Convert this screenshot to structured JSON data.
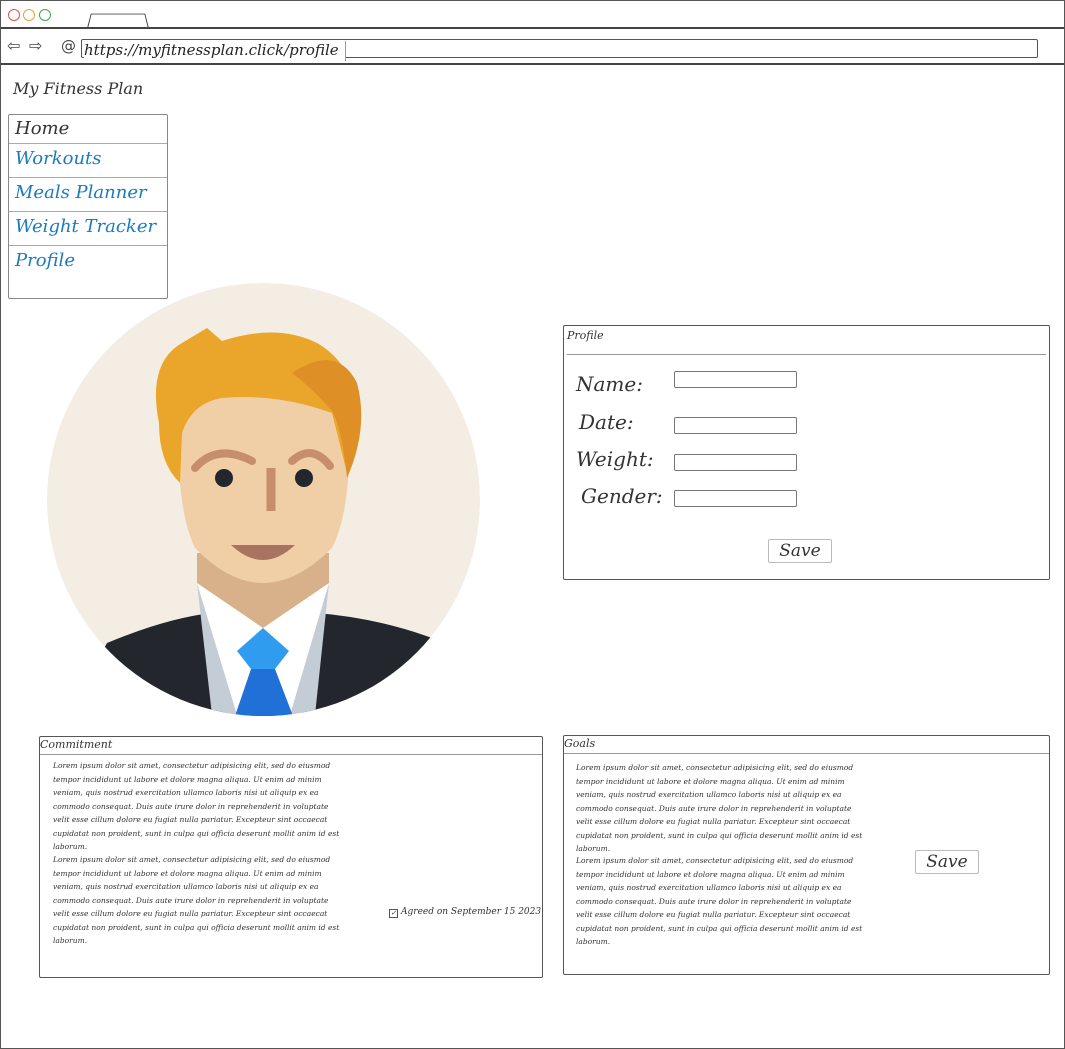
{
  "browser": {
    "url": "https://myfitnessplan.click/profile",
    "dot_colors": [
      "#d9534f",
      "#e8a33a",
      "#3fa34d"
    ]
  },
  "app": {
    "title": "My Fitness Plan"
  },
  "nav": {
    "items": [
      {
        "label": "Home"
      },
      {
        "label": "Workouts"
      },
      {
        "label": "Meals Planner"
      },
      {
        "label": "Weight Tracker"
      },
      {
        "label": "Profile"
      }
    ]
  },
  "profile_form": {
    "title": "Profile",
    "fields": [
      {
        "label": "Name:",
        "value": ""
      },
      {
        "label": "Date:",
        "value": ""
      },
      {
        "label": "Weight:",
        "value": ""
      },
      {
        "label": "Gender:",
        "value": ""
      }
    ],
    "save_label": "Save"
  },
  "commitment": {
    "title": "Commitment",
    "paragraphs": [
      "Lorem ipsum dolor sit amet, consectetur adipisicing elit, sed do eiusmod tempor incididunt ut labore et dolore magna aliqua. Ut enim ad minim veniam, quis nostrud exercitation ullamco laboris nisi ut aliquip ex ea commodo consequat. Duis aute irure dolor in reprehenderit in voluptate velit esse cillum dolore eu fugiat nulla pariatur. Excepteur sint occaecat cupidatat non proident, sunt in culpa qui officia deserunt mollit anim id est laborum.",
      "Lorem ipsum dolor sit amet, consectetur adipisicing elit, sed do eiusmod tempor incididunt ut labore et dolore magna aliqua. Ut enim ad minim veniam, quis nostrud exercitation ullamco laboris nisi ut aliquip ex ea commodo consequat. Duis aute irure dolor in reprehenderit in voluptate velit esse cillum dolore eu fugiat nulla pariatur. Excepteur sint occaecat cupidatat non proident, sunt in culpa qui officia deserunt mollit anim id est laborum."
    ],
    "agreement": {
      "label": "Agreed on September 15 2023",
      "checked": true
    }
  },
  "goals": {
    "title": "Goals",
    "paragraphs": [
      "Lorem ipsum dolor sit amet, consectetur adipisicing elit, sed do eiusmod tempor incididunt ut labore et dolore magna aliqua. Ut enim ad minim veniam, quis nostrud exercitation ullamco laboris nisi ut aliquip ex ea commodo consequat. Duis aute irure dolor in reprehenderit in voluptate velit esse cillum dolore eu fugiat nulla pariatur. Excepteur sint occaecat cupidatat non proident, sunt in culpa qui officia deserunt mollit anim id est laborum.",
      "Lorem ipsum dolor sit amet, consectetur adipisicing elit, sed do eiusmod tempor incididunt ut labore et dolore magna aliqua. Ut enim ad minim veniam, quis nostrud exercitation ullamco laboris nisi ut aliquip ex ea commodo consequat. Duis aute irure dolor in reprehenderit in voluptate velit esse cillum dolore eu fugiat nulla pariatur. Excepteur sint occaecat cupidatat non proident, sunt in culpa qui officia deserunt mollit anim id est laborum."
    ],
    "save_label": "Save"
  },
  "icons": {
    "back": "arrow-left-icon",
    "forward": "arrow-right-icon",
    "site": "globe-icon"
  },
  "colors": {
    "link": "#1a7bbd",
    "avatar_bg": "#f3ede4"
  }
}
